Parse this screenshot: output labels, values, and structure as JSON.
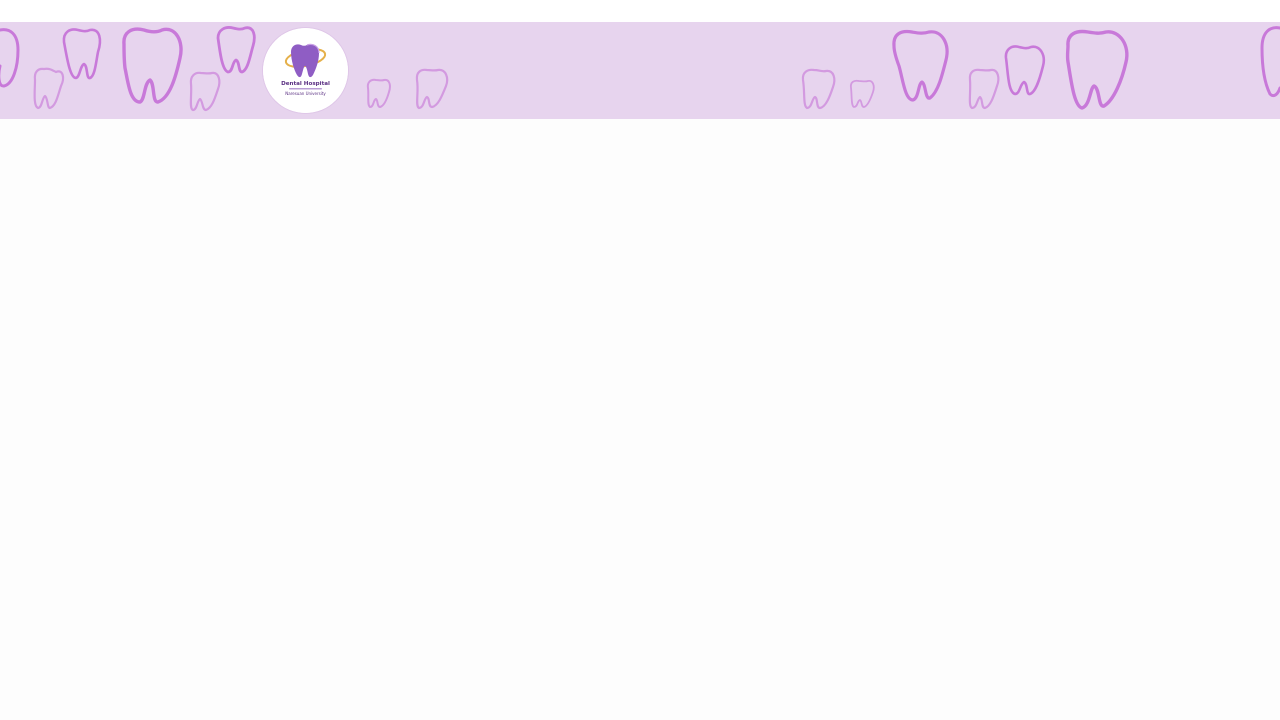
{
  "header": {
    "logo_line1": "Dental Hospital",
    "logo_line2": "Naresuan University"
  },
  "colors": {
    "banner_bg": "#e7d4ee",
    "tooth_stroke_strong": "#c879d9",
    "tooth_stroke_light": "#d39ae0",
    "logo_tooth": "#8f5dc4",
    "logo_orbit": "#e5b04a",
    "page_bg": "#fdfdfd"
  },
  "icons": {
    "pattern": "tooth-icon",
    "logo": "dental-hospital-logo"
  }
}
